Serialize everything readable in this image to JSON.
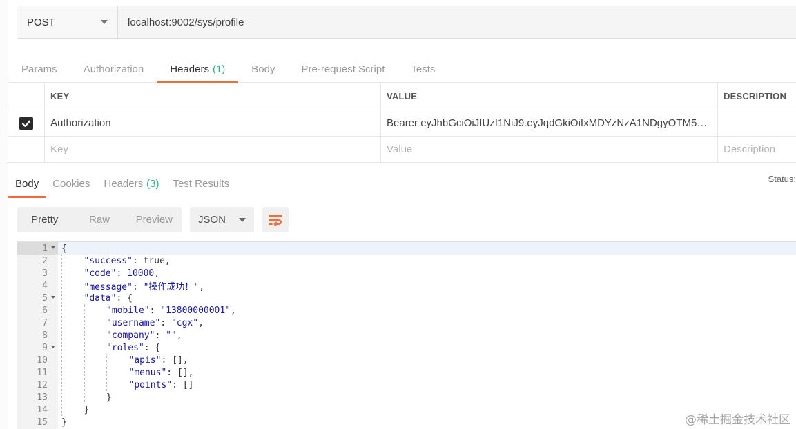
{
  "request": {
    "method": "POST",
    "url": "localhost:9002/sys/profile"
  },
  "request_tabs": [
    {
      "label": "Params",
      "count": ""
    },
    {
      "label": "Authorization",
      "count": ""
    },
    {
      "label": "Headers",
      "count": "(1)"
    },
    {
      "label": "Body",
      "count": ""
    },
    {
      "label": "Pre-request Script",
      "count": ""
    },
    {
      "label": "Tests",
      "count": ""
    }
  ],
  "headers_table": {
    "columns": {
      "key": "KEY",
      "value": "VALUE",
      "description": "DESCRIPTION"
    },
    "rows": [
      {
        "checked": true,
        "key": "Authorization",
        "value": "Bearer eyJhbGciOiJIUzI1NiJ9.eyJqdGkiOiIxMDYzNzA1NDgyOTM5N…",
        "description": ""
      }
    ],
    "placeholders": {
      "key": "Key",
      "value": "Value",
      "description": "Description"
    }
  },
  "response_tabs": [
    {
      "label": "Body",
      "count": ""
    },
    {
      "label": "Cookies",
      "count": ""
    },
    {
      "label": "Headers",
      "count": "(3)"
    },
    {
      "label": "Test Results",
      "count": ""
    }
  ],
  "status_label": "Status:",
  "view_modes": [
    "Pretty",
    "Raw",
    "Preview"
  ],
  "format": "JSON",
  "icons": {
    "wrap": "wrap-lines-icon",
    "check": "check-icon",
    "caret": "chevron-down-icon"
  },
  "colors": {
    "accent": "#f26b3a",
    "count": "#26b47f",
    "json_value": "#1a1aa6"
  },
  "code_lines": [
    {
      "n": "1",
      "fold": true,
      "indent": 0,
      "tokens": [
        [
          "p",
          "{"
        ]
      ]
    },
    {
      "n": "2",
      "fold": false,
      "indent": 1,
      "tokens": [
        [
          "k",
          "\"success\""
        ],
        [
          "p",
          ": "
        ],
        [
          "p",
          "true"
        ],
        [
          "p",
          ","
        ]
      ]
    },
    {
      "n": "3",
      "fold": false,
      "indent": 1,
      "tokens": [
        [
          "k",
          "\"code\""
        ],
        [
          "p",
          ": "
        ],
        [
          "n",
          "10000"
        ],
        [
          "p",
          ","
        ]
      ]
    },
    {
      "n": "4",
      "fold": false,
      "indent": 1,
      "tokens": [
        [
          "k",
          "\"message\""
        ],
        [
          "p",
          ": "
        ],
        [
          "s",
          "\"操作成功！\""
        ],
        [
          "p",
          ","
        ]
      ]
    },
    {
      "n": "5",
      "fold": true,
      "indent": 1,
      "tokens": [
        [
          "k",
          "\"data\""
        ],
        [
          "p",
          ": {"
        ]
      ]
    },
    {
      "n": "6",
      "fold": false,
      "indent": 2,
      "tokens": [
        [
          "k",
          "\"mobile\""
        ],
        [
          "p",
          ": "
        ],
        [
          "s",
          "\"13800000001\""
        ],
        [
          "p",
          ","
        ]
      ]
    },
    {
      "n": "7",
      "fold": false,
      "indent": 2,
      "tokens": [
        [
          "k",
          "\"username\""
        ],
        [
          "p",
          ": "
        ],
        [
          "s",
          "\"cgx\""
        ],
        [
          "p",
          ","
        ]
      ]
    },
    {
      "n": "8",
      "fold": false,
      "indent": 2,
      "tokens": [
        [
          "k",
          "\"company\""
        ],
        [
          "p",
          ": "
        ],
        [
          "s",
          "\"\""
        ],
        [
          "p",
          ","
        ]
      ]
    },
    {
      "n": "9",
      "fold": true,
      "indent": 2,
      "tokens": [
        [
          "k",
          "\"roles\""
        ],
        [
          "p",
          ": {"
        ]
      ]
    },
    {
      "n": "10",
      "fold": false,
      "indent": 3,
      "tokens": [
        [
          "k",
          "\"apis\""
        ],
        [
          "p",
          ": [],"
        ]
      ]
    },
    {
      "n": "11",
      "fold": false,
      "indent": 3,
      "tokens": [
        [
          "k",
          "\"menus\""
        ],
        [
          "p",
          ": [],"
        ]
      ]
    },
    {
      "n": "12",
      "fold": false,
      "indent": 3,
      "tokens": [
        [
          "k",
          "\"points\""
        ],
        [
          "p",
          ": []"
        ]
      ]
    },
    {
      "n": "13",
      "fold": false,
      "indent": 2,
      "tokens": [
        [
          "p",
          "}"
        ]
      ]
    },
    {
      "n": "14",
      "fold": false,
      "indent": 1,
      "tokens": [
        [
          "p",
          "}"
        ]
      ]
    },
    {
      "n": "15",
      "fold": false,
      "indent": 0,
      "tokens": [
        [
          "p",
          "}"
        ]
      ]
    }
  ],
  "watermark": "@稀土掘金技术社区"
}
